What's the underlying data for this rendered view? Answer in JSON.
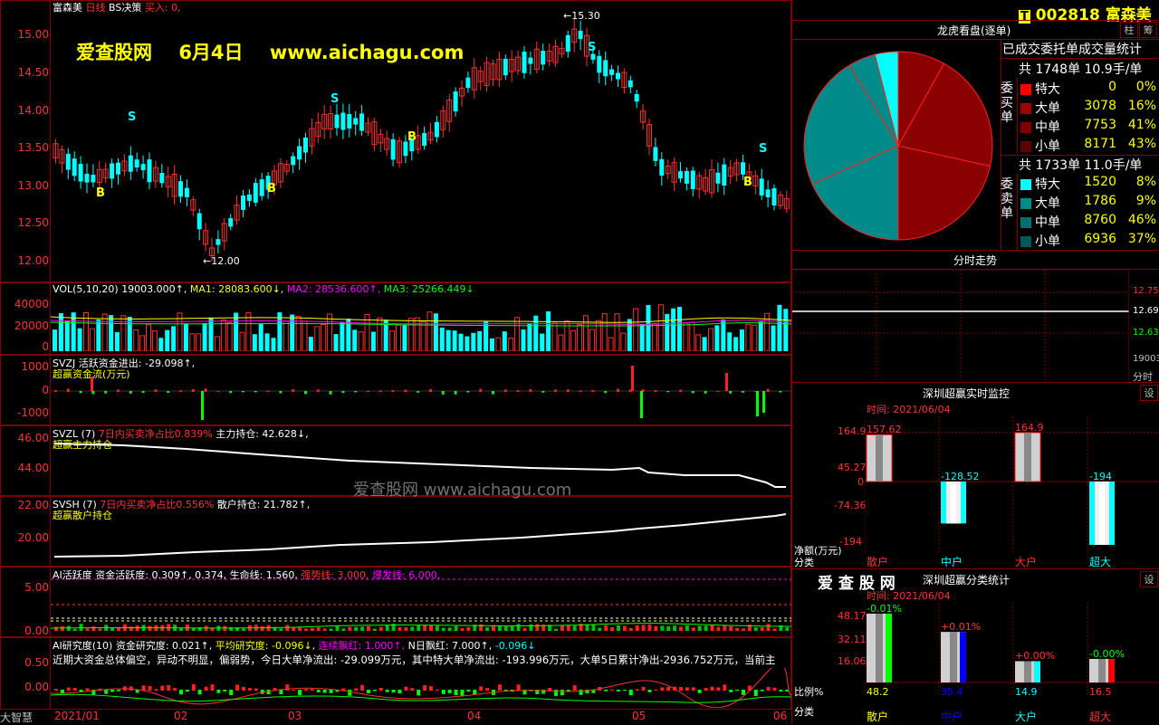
{
  "header": {
    "stock_name": "富森美",
    "period": "日线",
    "strategy": "BS决策",
    "buy_label": "买入: 0,",
    "watermark_site": "爱查股网",
    "watermark_date": "6月4日",
    "watermark_url": "www.aichagu.com",
    "high_marker": "15.30",
    "low_marker": "12.00"
  },
  "main_chart": {
    "y_ticks": [
      "15.00",
      "14.50",
      "14.00",
      "13.50",
      "13.00",
      "12.50",
      "12.00"
    ],
    "signals": [
      "B",
      "B",
      "B",
      "B",
      "S",
      "S",
      "S",
      "S"
    ]
  },
  "vol_panel": {
    "label": "VOL(5,10,20)",
    "value": "19003.000↑,",
    "ma1": "MA1: 28083.600↓,",
    "ma2": "MA2: 28536.600↑,",
    "ma3": "MA3: 25266.449↓",
    "y_ticks": [
      "40000",
      "20000",
      "0"
    ]
  },
  "svzj_panel": {
    "label": "SVZJ",
    "desc": "活跃资金进出: -29.098↑,",
    "sub": "超赢资金流(万元)",
    "y_ticks": [
      "1000",
      "0",
      "-1000"
    ]
  },
  "svzl_panel": {
    "label": "SVZL (7)",
    "desc": "7日内买卖净占比0.839%",
    "desc2": "主力持仓: 42.628↓,",
    "sub": "超赢主力持仓",
    "y_ticks": [
      "46.00",
      "44.00"
    ]
  },
  "svsh_panel": {
    "label": "SVSH (7)",
    "desc": "7日内买卖净占比0.556%",
    "desc2": "散户持仓: 21.782↑,",
    "sub": "超赢散户持仓",
    "y_ticks": [
      "22.00",
      "20.00"
    ],
    "watermark": "爱查股网    www.aichagu.com"
  },
  "ai_active": {
    "label": "AI活跃度",
    "desc": "资金活跃度: 0.309↑, 0.374, 生命线: 1.560,",
    "strong": "强势线: 3.000,",
    "burst": "爆发线: 6.000,",
    "y_ticks": [
      "5.00",
      "0.00"
    ]
  },
  "ai_research": {
    "label": "AI研究度(10)",
    "desc": "资金研究度: 0.021↑,",
    "avg": "平均研究度: -0.096↓,",
    "cont": "连续飘红: 1.000↑,",
    "nday": "N日飘红: 7.000↑,",
    "neg": "-0.096↓",
    "summary": "近期大资金总体偏空，异动不明显，偏弱势，今日大单净流出: -29.099万元，其中特大单净流出: -193.996万元，大单5日累计净出-2936.752万元，当前主",
    "y_ticks": [
      "0.50",
      "0.00"
    ]
  },
  "x_axis": [
    "2021/01",
    "02",
    "03",
    "04",
    "05",
    "06"
  ],
  "bottom_label": "大智慧",
  "right": {
    "code": "002818",
    "name": "富森美",
    "btn_col": "柱",
    "btn_grid": "筹",
    "dragon_title": "龙虎看盘(逐单)",
    "stats_title": "已成交委托单成交量统计",
    "buy_total": "共 1748单 10.9手/单",
    "sell_total": "共 1733单 11.0手/单",
    "buy_side": "委买单",
    "sell_side": "委卖单",
    "buy_rows": [
      {
        "name": "特大",
        "vol": "0",
        "pct": "0%",
        "color": "#ff0000"
      },
      {
        "name": "大单",
        "vol": "3078",
        "pct": "16%",
        "color": "#a00000"
      },
      {
        "name": "中单",
        "vol": "7753",
        "pct": "41%",
        "color": "#800000"
      },
      {
        "name": "小单",
        "vol": "8171",
        "pct": "43%",
        "color": "#600000"
      }
    ],
    "sell_rows": [
      {
        "name": "特大",
        "vol": "1520",
        "pct": "8%",
        "color": "#00ffff"
      },
      {
        "name": "大单",
        "vol": "1786",
        "pct": "9%",
        "color": "#008b8b"
      },
      {
        "name": "中单",
        "vol": "8760",
        "pct": "46%",
        "color": "#007070"
      },
      {
        "name": "小单",
        "vol": "6936",
        "pct": "37%",
        "color": "#005858"
      }
    ],
    "intraday_title": "分时走势",
    "intraday_ticks": [
      "12.75",
      "12.69",
      "12.63",
      "19003",
      "分时"
    ],
    "monitor_title": "深圳超赢实时监控",
    "monitor_btn": "设",
    "monitor_time": "时间: 2021/06/04",
    "monitor_yticks": [
      "164.9",
      "45.27",
      "0",
      "-74.36",
      "-194"
    ],
    "monitor_ylabel": "净额(万元)",
    "monitor_xlabel": "分类",
    "monitor_bars": [
      {
        "name": "散户",
        "value": "157.62"
      },
      {
        "name": "中户",
        "value": "-128.52"
      },
      {
        "name": "大户",
        "value": "164.9"
      },
      {
        "name": "超大",
        "value": "-194"
      }
    ],
    "classify_brand": "爱 查 股 网",
    "classify_title": "深圳超赢分类统计",
    "classify_btn": "设",
    "classify_time": "时间: 2021/06/04",
    "classify_yticks": [
      "48.17",
      "32.11",
      "16.06",
      "0"
    ],
    "classify_ylabel": "比例%",
    "classify_xlabel": "分类",
    "classify_bars": [
      {
        "name": "散户",
        "value": "48.2",
        "change": "-0.01%"
      },
      {
        "name": "中户",
        "value": "35.4",
        "change": "+0.01%"
      },
      {
        "name": "大户",
        "value": "14.9",
        "change": "+0.00%"
      },
      {
        "name": "超大",
        "value": "16.5",
        "change": "-0.00%"
      }
    ]
  },
  "chart_data": {
    "type": "pie",
    "title": "龙虎看盘(逐单)",
    "slices": [
      {
        "label": "委买单 特大",
        "value": 0
      },
      {
        "label": "委买单 大单",
        "value": 3078
      },
      {
        "label": "委买单 中单",
        "value": 7753
      },
      {
        "label": "委买单 小单",
        "value": 8171
      },
      {
        "label": "委卖单 特大",
        "value": 1520
      },
      {
        "label": "委卖单 大单",
        "value": 1786
      },
      {
        "label": "委卖单 中单",
        "value": 8760
      },
      {
        "label": "委卖单 小单",
        "value": 6936
      }
    ]
  }
}
